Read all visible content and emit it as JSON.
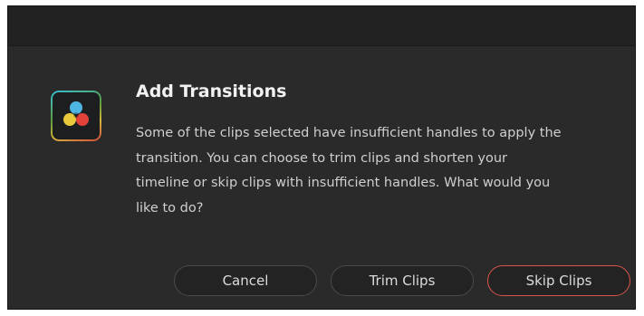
{
  "dialog": {
    "title": "Add Transitions",
    "message": "Some of the clips selected have insufficient handles to apply the transition. You can choose to trim clips and shorten your timeline or skip clips with insufficient handles. What would you like to do?",
    "icon": "davinci-resolve-app-icon"
  },
  "buttons": {
    "cancel_label": "Cancel",
    "trim_label": "Trim Clips",
    "skip_label": "Skip Clips"
  },
  "colors": {
    "dialog_background": "#2a2a2b",
    "title_text": "#f2f2f2",
    "body_text": "#cfcfcf",
    "default_button_border": "#d8554a"
  }
}
